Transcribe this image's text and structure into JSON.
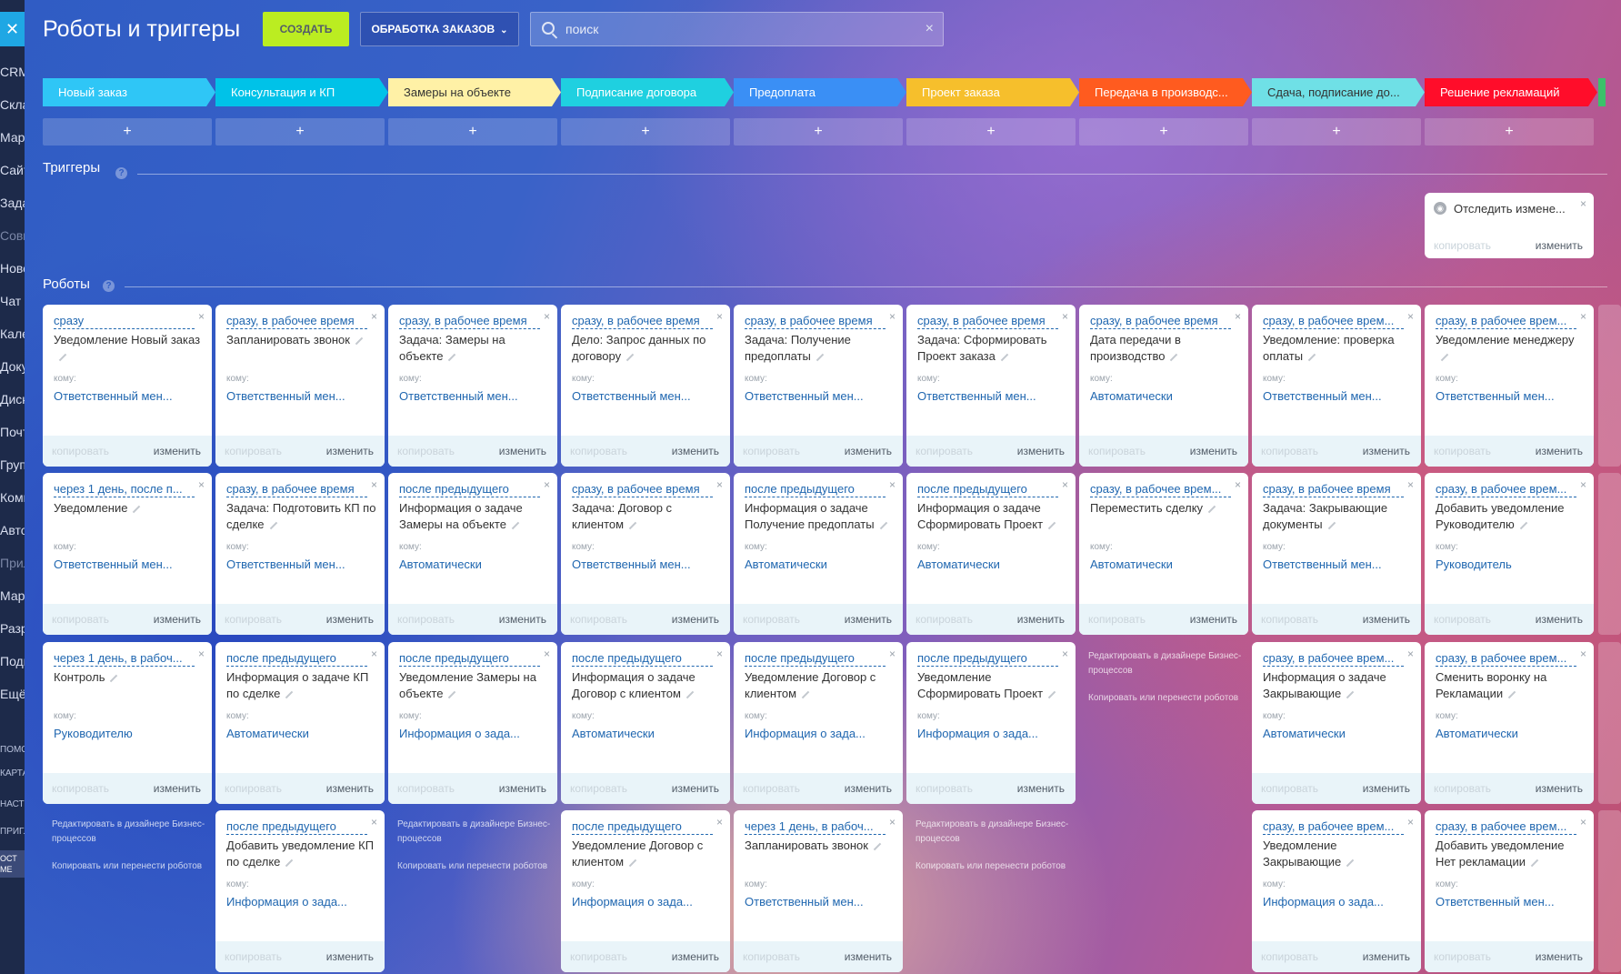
{
  "header": {
    "title": "Роботы и триггеры",
    "create_label": "СОЗДАТЬ",
    "pipeline_label": "ОБРАБОТКА ЗАКАЗОВ",
    "search_placeholder": "поиск"
  },
  "sidebar": {
    "items": [
      "CRM",
      "Скла",
      "Марк",
      "Сайт",
      "Зада",
      "Совм",
      "Ново",
      "Чат и",
      "Кале",
      "Доку",
      "Диск",
      "Почт",
      "Груп",
      "Комп",
      "Авто",
      "Прил",
      "Марк",
      "Разр",
      "Подк",
      "Ещё"
    ],
    "bottom": [
      "ПОМО",
      "КАРТА",
      "НАСТР",
      "ПРИГЛ"
    ],
    "avatar": [
      "ОСТ",
      "МЕ"
    ]
  },
  "stages": [
    {
      "name": "Новый заказ",
      "color": "#2fc6f6"
    },
    {
      "name": "Консультация и КП",
      "color": "#00c2e8"
    },
    {
      "name": "Замеры на объекте",
      "color": "#fff1a6"
    },
    {
      "name": "Подписание договора",
      "color": "#1fd0e0"
    },
    {
      "name": "Предоплата",
      "color": "#3a8ff5"
    },
    {
      "name": "Проект заказа",
      "color": "#f6bf2c"
    },
    {
      "name": "Передача в производс...",
      "color": "#ff5b1f"
    },
    {
      "name": "Сдача, подписание до...",
      "color": "#6fe0e6"
    },
    {
      "name": "Решение рекламаций",
      "color": "#ff0d2a"
    }
  ],
  "add_symbol": "+",
  "triggers": {
    "title": "Триггеры",
    "help": "?",
    "card": {
      "title": "Отследить измене...",
      "copy": "копировать",
      "edit": "изменить",
      "close": "×"
    }
  },
  "robots": {
    "title": "Роботы",
    "help": "?",
    "who_label": "кому:",
    "copy_label": "копировать",
    "edit_label": "изменить",
    "close": "×",
    "note_line1": "Редактировать в дизайнере Бизнес-процессов",
    "note_line2": "Копировать или перенести роботов",
    "columns": [
      [
        {
          "delay": "сразу",
          "title": "Уведомление Новый заказ",
          "to": "Ответственный мен..."
        },
        {
          "delay": "через 1 день, после п...",
          "title": "Уведомление",
          "to": "Ответственный мен..."
        },
        {
          "delay": "через 1 день, в рабоч...",
          "title": "Контроль",
          "to": "Руководителю"
        }
      ],
      [
        {
          "delay": "сразу, в рабочее время",
          "title": "Запланировать звонок",
          "to": "Ответственный мен..."
        },
        {
          "delay": "сразу, в рабочее время",
          "title": "Задача: Подготовить КП по сделке",
          "to": "Ответственный мен..."
        },
        {
          "delay": "после предыдущего",
          "title": "Информация о задаче КП по сделке",
          "to": "Автоматически"
        },
        {
          "delay": "после предыдущего",
          "title": "Добавить уведомление КП по сделке",
          "to": "Информация о зада..."
        }
      ],
      [
        {
          "delay": "сразу, в рабочее время",
          "title": "Задача: Замеры на объекте",
          "to": "Ответственный мен..."
        },
        {
          "delay": "после предыдущего",
          "title": "Информация о задаче Замеры на объекте",
          "to": "Автоматически"
        },
        {
          "delay": "после предыдущего",
          "title": "Уведомление Замеры на объекте",
          "to": "Информация о зада..."
        }
      ],
      [
        {
          "delay": "сразу, в рабочее время",
          "title": "Дело: Запрос данных по договору",
          "to": "Ответственный мен..."
        },
        {
          "delay": "сразу, в рабочее время",
          "title": "Задача: Договор с клиентом",
          "to": "Ответственный мен..."
        },
        {
          "delay": "после предыдущего",
          "title": "Информация о задаче Договор с клиентом",
          "to": "Автоматически"
        },
        {
          "delay": "после предыдущего",
          "title": "Уведомление Договор с клиентом",
          "to": "Информация о зада..."
        }
      ],
      [
        {
          "delay": "сразу, в рабочее время",
          "title": "Задача: Получение предоплаты",
          "to": "Ответственный мен..."
        },
        {
          "delay": "после предыдущего",
          "title": "Информация о задаче Получение предоплаты",
          "to": "Автоматически"
        },
        {
          "delay": "после предыдущего",
          "title": "Уведомление Договор с клиентом",
          "to": "Информация о зада..."
        },
        {
          "delay": "через 1 день, в рабоч...",
          "title": "Запланировать звонок",
          "to": "Ответственный мен..."
        }
      ],
      [
        {
          "delay": "сразу, в рабочее время",
          "title": "Задача: Сформировать Проект заказа",
          "to": "Ответственный мен..."
        },
        {
          "delay": "после предыдущего",
          "title": "Информация о задаче Сформировать Проект",
          "to": "Автоматически"
        },
        {
          "delay": "после предыдущего",
          "title": "Уведомление Сформировать Проект",
          "to": "Информация о зада..."
        }
      ],
      [
        {
          "delay": "сразу, в рабочее время",
          "title": "Дата передачи в производство",
          "to": "Автоматически"
        },
        {
          "delay": "сразу, в рабочее врем...",
          "title": "Переместить сделку",
          "to": "Автоматически"
        }
      ],
      [
        {
          "delay": "сразу, в рабочее врем...",
          "title": "Уведомление: проверка оплаты",
          "to": "Ответственный мен..."
        },
        {
          "delay": "сразу, в рабочее время",
          "title": "Задача: Закрывающие документы",
          "to": "Ответственный мен..."
        },
        {
          "delay": "сразу, в рабочее врем...",
          "title": "Информация о задаче Закрывающие",
          "to": "Автоматически"
        },
        {
          "delay": "сразу, в рабочее врем...",
          "title": "Уведомление Закрывающие",
          "to": "Информация о зада..."
        }
      ],
      [
        {
          "delay": "сразу, в рабочее врем...",
          "title": "Уведомление менеджеру",
          "to": "Ответственный мен..."
        },
        {
          "delay": "сразу, в рабочее врем...",
          "title": "Добавить уведомление Руководителю",
          "to": "Руководитель"
        },
        {
          "delay": "сразу, в рабочее врем...",
          "title": "Сменить воронку на Рекламации",
          "to": "Автоматически"
        },
        {
          "delay": "сразу, в рабочее врем...",
          "title": "Добавить уведомление Нет рекламации",
          "to": "Ответственный мен..."
        }
      ]
    ]
  }
}
